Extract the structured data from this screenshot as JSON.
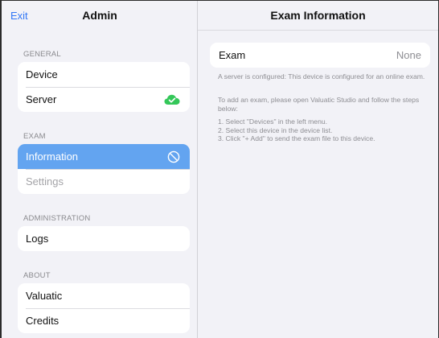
{
  "sidebar": {
    "exit_label": "Exit",
    "title": "Admin",
    "sections": {
      "general": {
        "label": "GENERAL",
        "items": [
          {
            "label": "Device"
          },
          {
            "label": "Server",
            "status_icon": "cloud-check-icon",
            "status_color": "#34c759"
          }
        ]
      },
      "exam": {
        "label": "EXAM",
        "items": [
          {
            "label": "Information",
            "selected": true,
            "trail_icon": "prohibited-icon"
          },
          {
            "label": "Settings",
            "disabled": true
          }
        ]
      },
      "administration": {
        "label": "ADMINISTRATION",
        "items": [
          {
            "label": "Logs"
          }
        ]
      },
      "about": {
        "label": "ABOUT",
        "items": [
          {
            "label": "Valuatic"
          },
          {
            "label": "Credits"
          }
        ]
      }
    }
  },
  "detail": {
    "title": "Exam Information",
    "exam_row": {
      "key": "Exam",
      "value": "None"
    },
    "note_server": "A server is configured: This device is configured for an online exam.",
    "note_intro": "To add an exam, please open Valuatic Studio and follow the steps below:",
    "steps": [
      "1. Select \"Devices\" in the left menu.",
      "2. Select this device in the device list.",
      "3. Click \"+ Add\" to send the exam file to this device."
    ]
  },
  "colors": {
    "accent": "#3478f6",
    "selected_row": "#63a4f0",
    "success": "#34c759"
  }
}
